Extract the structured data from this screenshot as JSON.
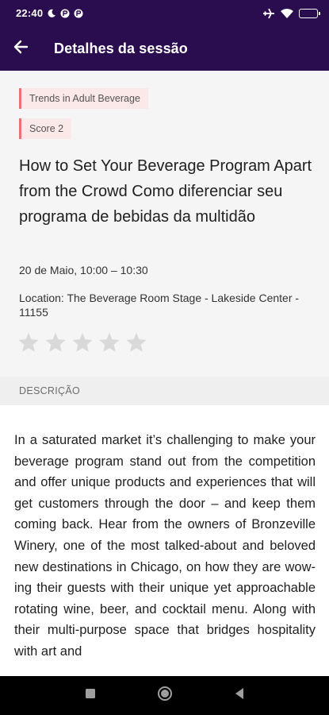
{
  "status_bar": {
    "time": "22:40",
    "icons": [
      "moon-icon",
      "app-icon",
      "app-icon",
      "airplane-icon",
      "wifi-icon",
      "battery-icon"
    ],
    "battery_color": "#4cd964"
  },
  "app_bar": {
    "title": "Detalhes da sessão",
    "background": "#2a0d4f",
    "back_icon": "arrow-left-icon"
  },
  "session": {
    "track_tag": "Trends in Adult Beverage",
    "score_tag": "Score 2",
    "title": "How to Set Your Beverage Program Apart from the Crowd Como diferenciar seu programa de bebidas da multidão",
    "time": "20 de Maio,  10:00 – 10:30",
    "location": "Location: The Beverage Room Stage - Lakeside Center - 11155",
    "rating": {
      "value": 0,
      "max": 5,
      "icon": "star-icon"
    }
  },
  "description_section": {
    "header": "DESCRIÇÃO",
    "text": "In a saturated market it’s challenging to make your beverage program stand out from the competition and offer unique products and experiences that will get customers through the door – and keep them coming back. Hear from the owners of Bronzeville Winery, one of the most talked-about and beloved new destinations in Chicago, on how they are wow-ing their guests with their unique yet approachable rotating wine, beer, and cocktail menu. Along with their multi-purpose space that bridges hospitality with art and"
  },
  "nav_bar": {
    "buttons": [
      "recents-icon",
      "home-icon",
      "back-icon"
    ]
  }
}
